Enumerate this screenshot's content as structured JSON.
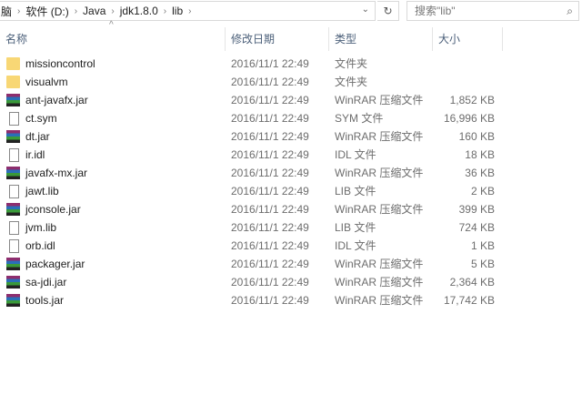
{
  "breadcrumb": [
    "脑",
    "软件 (D:)",
    "Java",
    "jdk1.8.0",
    "lib"
  ],
  "search": {
    "placeholder": "搜索\"lib\""
  },
  "columns": {
    "name": "名称",
    "date": "修改日期",
    "type": "类型",
    "size": "大小"
  },
  "files": [
    {
      "name": "missioncontrol",
      "date": "2016/11/1 22:49",
      "type": "文件夹",
      "size": "",
      "icon": "folder"
    },
    {
      "name": "visualvm",
      "date": "2016/11/1 22:49",
      "type": "文件夹",
      "size": "",
      "icon": "folder"
    },
    {
      "name": "ant-javafx.jar",
      "date": "2016/11/1 22:49",
      "type": "WinRAR 压缩文件",
      "size": "1,852 KB",
      "icon": "rar"
    },
    {
      "name": "ct.sym",
      "date": "2016/11/1 22:49",
      "type": "SYM 文件",
      "size": "16,996 KB",
      "icon": "file"
    },
    {
      "name": "dt.jar",
      "date": "2016/11/1 22:49",
      "type": "WinRAR 压缩文件",
      "size": "160 KB",
      "icon": "rar"
    },
    {
      "name": "ir.idl",
      "date": "2016/11/1 22:49",
      "type": "IDL 文件",
      "size": "18 KB",
      "icon": "file"
    },
    {
      "name": "javafx-mx.jar",
      "date": "2016/11/1 22:49",
      "type": "WinRAR 压缩文件",
      "size": "36 KB",
      "icon": "rar"
    },
    {
      "name": "jawt.lib",
      "date": "2016/11/1 22:49",
      "type": "LIB 文件",
      "size": "2 KB",
      "icon": "file"
    },
    {
      "name": "jconsole.jar",
      "date": "2016/11/1 22:49",
      "type": "WinRAR 压缩文件",
      "size": "399 KB",
      "icon": "rar"
    },
    {
      "name": "jvm.lib",
      "date": "2016/11/1 22:49",
      "type": "LIB 文件",
      "size": "724 KB",
      "icon": "file"
    },
    {
      "name": "orb.idl",
      "date": "2016/11/1 22:49",
      "type": "IDL 文件",
      "size": "1 KB",
      "icon": "file"
    },
    {
      "name": "packager.jar",
      "date": "2016/11/1 22:49",
      "type": "WinRAR 压缩文件",
      "size": "5 KB",
      "icon": "rar"
    },
    {
      "name": "sa-jdi.jar",
      "date": "2016/11/1 22:49",
      "type": "WinRAR 压缩文件",
      "size": "2,364 KB",
      "icon": "rar"
    },
    {
      "name": "tools.jar",
      "date": "2016/11/1 22:49",
      "type": "WinRAR 压缩文件",
      "size": "17,742 KB",
      "icon": "rar"
    }
  ]
}
